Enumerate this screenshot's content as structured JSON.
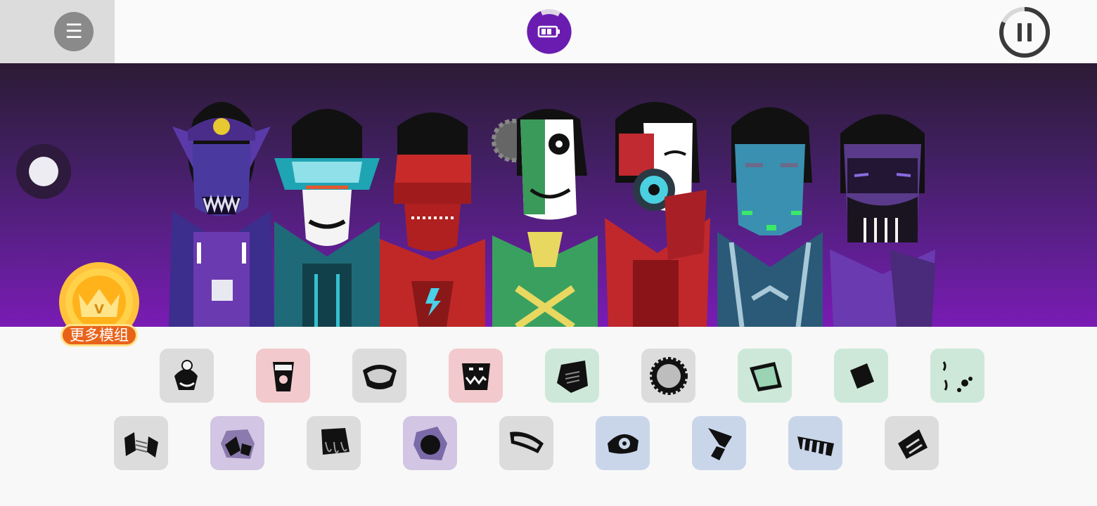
{
  "top_bar": {
    "menu_icon": "hamburger-icon",
    "menu_glyph": "☰",
    "battery_icon": "battery-icon",
    "pause_icon": "pause-icon"
  },
  "vip_badge": {
    "label": "更多模组",
    "crown_letter": "V"
  },
  "colors": {
    "stage_top": "#2c1b35",
    "stage_bottom": "#7a1bb4",
    "accent_purple": "#6a1cb0",
    "tile_gray": "#dcdcdc",
    "tile_red": "#f2c9cc",
    "tile_green": "#cde8d8",
    "tile_purple": "#d2c6e4",
    "tile_blue": "#c9d6ea",
    "vip_orange": "#e8631a",
    "vip_gold": "#ffc23a"
  },
  "characters": [
    {
      "name": "purple-skull-singer"
    },
    {
      "name": "cyan-visor-singer"
    },
    {
      "name": "red-robot-singer"
    },
    {
      "name": "green-gear-singer"
    },
    {
      "name": "red-eye-singer"
    },
    {
      "name": "blue-mask-singer"
    },
    {
      "name": "violet-tentacle-singer"
    }
  ],
  "sound_icons": {
    "row1": [
      {
        "icon": "skull-hat-sound-icon",
        "tint": "gray"
      },
      {
        "icon": "cup-sound-icon",
        "tint": "red"
      },
      {
        "icon": "visor-sound-icon",
        "tint": "gray"
      },
      {
        "icon": "fangs-sound-icon",
        "tint": "red"
      },
      {
        "icon": "pentagon-sound-icon",
        "tint": "green"
      },
      {
        "icon": "gear-sound-icon",
        "tint": "gray"
      },
      {
        "icon": "mask-sound-icon",
        "tint": "green"
      },
      {
        "icon": "square-sound-icon",
        "tint": "green"
      },
      {
        "icon": "dots-sound-icon",
        "tint": "green"
      }
    ],
    "row2": [
      {
        "icon": "cable-sound-icon",
        "tint": "gray"
      },
      {
        "icon": "splash-sound-icon",
        "tint": "purple"
      },
      {
        "icon": "tentacle-sound-icon",
        "tint": "gray"
      },
      {
        "icon": "star-sound-icon",
        "tint": "purple"
      },
      {
        "icon": "band-sound-icon",
        "tint": "gray"
      },
      {
        "icon": "eye-sound-icon",
        "tint": "blue"
      },
      {
        "icon": "bolt-sound-icon",
        "tint": "blue"
      },
      {
        "icon": "stripes-sound-icon",
        "tint": "blue"
      },
      {
        "icon": "hood-sound-icon",
        "tint": "gray"
      }
    ]
  }
}
